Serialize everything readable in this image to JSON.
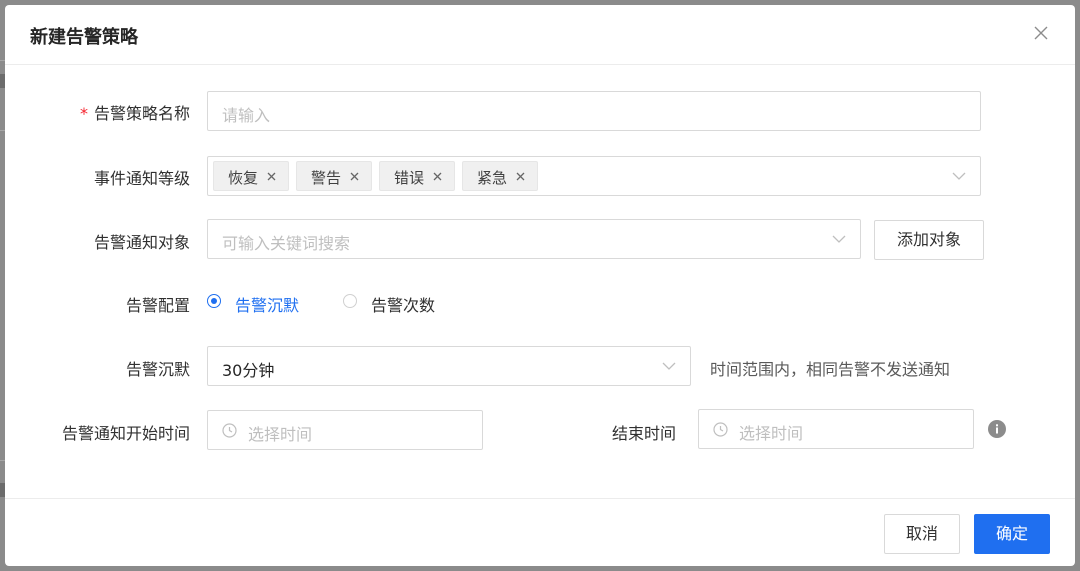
{
  "modal": {
    "title": "新建告警策略"
  },
  "form": {
    "policy_name": {
      "label": "告警策略名称",
      "placeholder": "请输入"
    },
    "event_level": {
      "label": "事件通知等级",
      "tags": [
        "恢复",
        "警告",
        "错误",
        "紧急"
      ]
    },
    "notify_target": {
      "label": "告警通知对象",
      "placeholder": "可输入关键词搜索",
      "add_button": "添加对象"
    },
    "alert_config": {
      "label": "告警配置",
      "options": [
        "告警沉默",
        "告警次数"
      ],
      "selected": "告警沉默"
    },
    "alert_silence": {
      "label": "告警沉默",
      "value": "30分钟",
      "hint": "时间范围内，相同告警不发送通知"
    },
    "notify_start": {
      "label": "告警通知开始时间",
      "placeholder": "选择时间"
    },
    "notify_end": {
      "label": "结束时间",
      "placeholder": "选择时间"
    }
  },
  "footer": {
    "cancel": "取消",
    "confirm": "确定"
  },
  "colors": {
    "primary": "#1f6ff0",
    "required": "#f5222d"
  },
  "icons": [
    "close-icon",
    "chevron-down-icon",
    "tag-close-icon",
    "clock-icon",
    "info-icon"
  ]
}
